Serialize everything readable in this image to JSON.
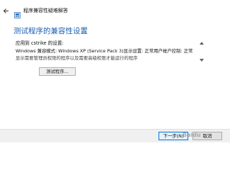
{
  "window": {
    "title": "程序兼容性疑难解答"
  },
  "main": {
    "heading": "测试程序的兼容性设置",
    "applied_label": "应用到 cstrike 的设置:",
    "settings_line_1": "Windows 兼容模式: Windows XP (Service Pack 3)显示设置: 正常用户帐户控制: 正常",
    "settings_line_2": "显示需要管理员权限的程序以及需要高级权限才能运行的程序",
    "test_button_label": "测试程序..."
  },
  "footer": {
    "next_label": "下一步(N)",
    "cancel_label": "取消",
    "watermark": "Baidu"
  },
  "colors": {
    "heading": "#1a5fb4",
    "footer_bg": "#f0f0f0",
    "primary_border": "#0078d7"
  }
}
